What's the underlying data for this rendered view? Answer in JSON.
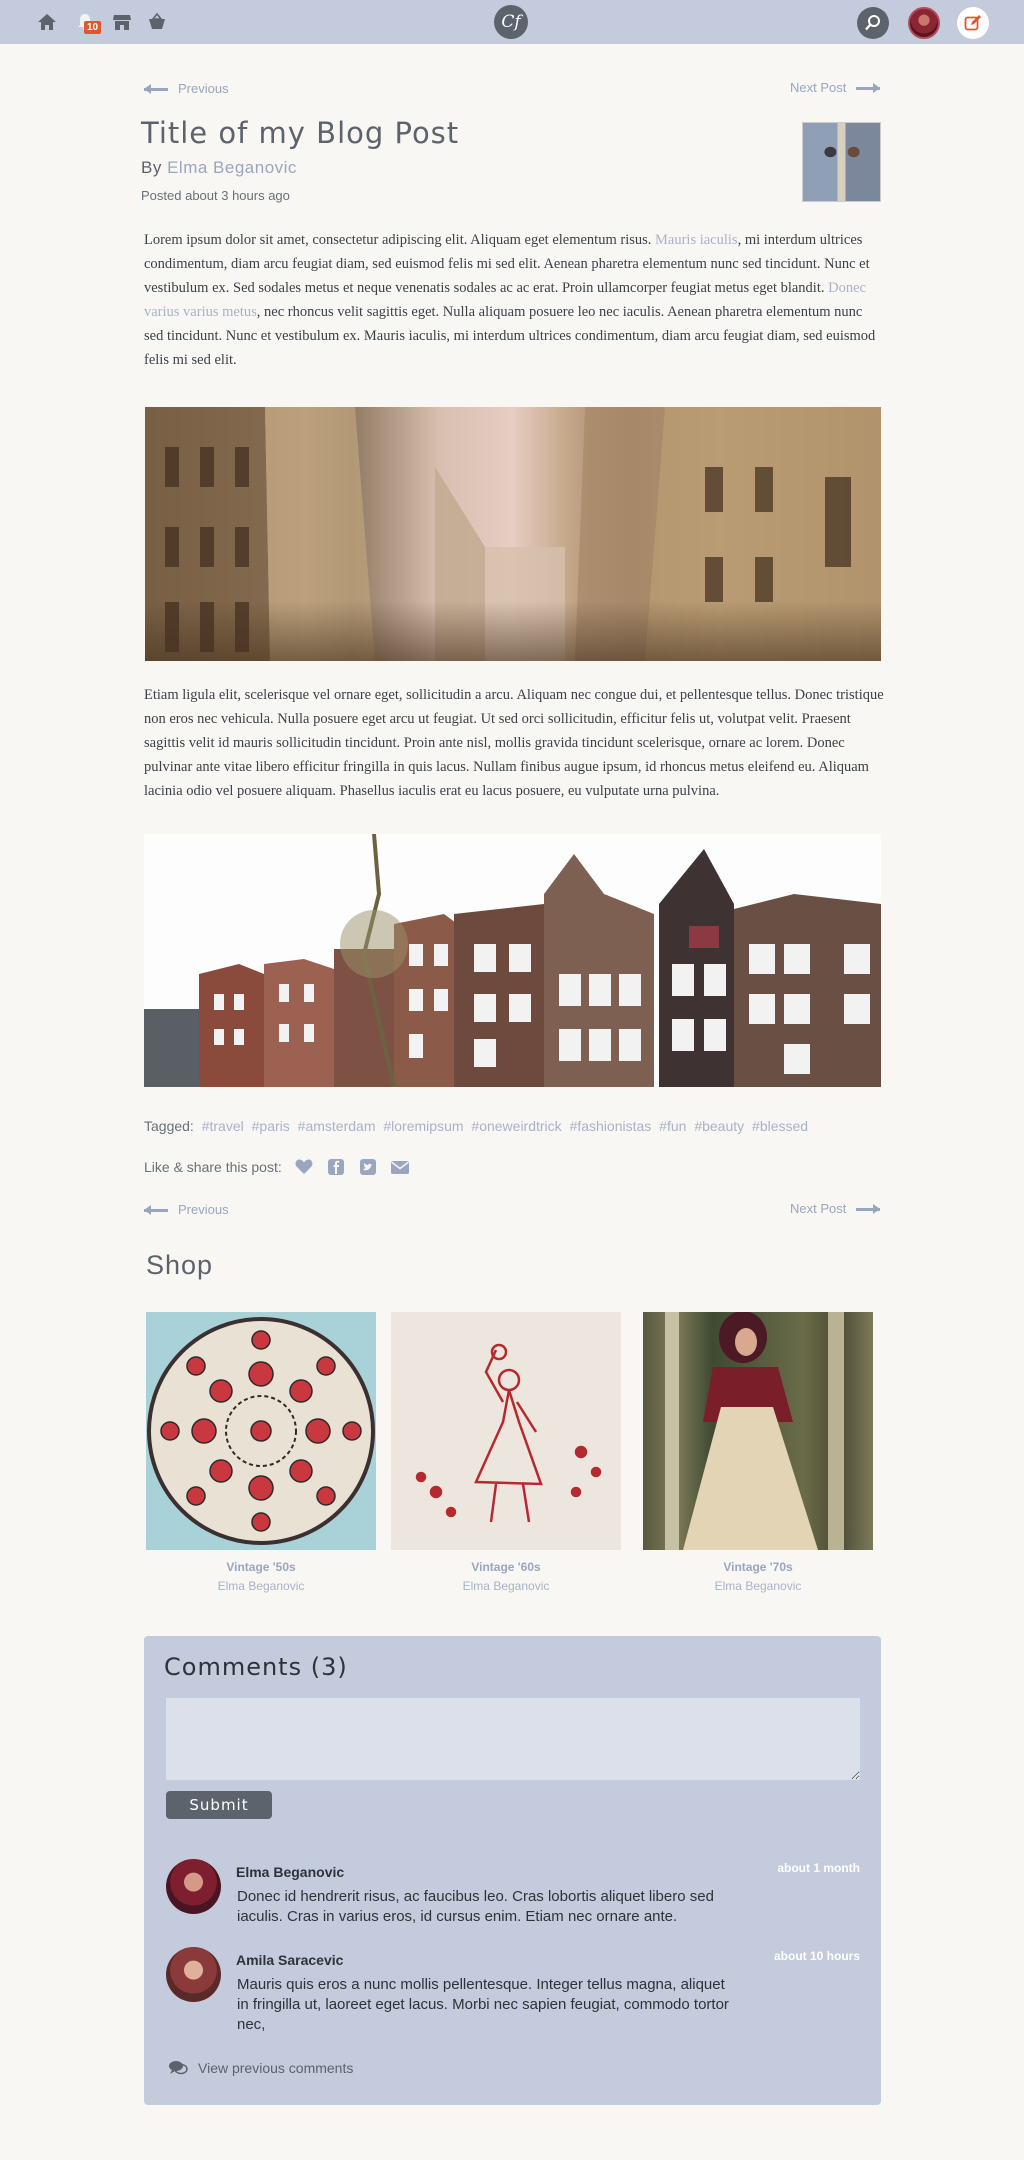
{
  "topbar": {
    "icons": [
      "home-icon",
      "notification-icon",
      "store-icon",
      "basket-icon"
    ],
    "notification_count": "10",
    "logo_text": "Cf",
    "right_icons": [
      "search-icon",
      "avatar",
      "compose-icon"
    ]
  },
  "nav": {
    "previous": "Previous",
    "next": "Next Post"
  },
  "post": {
    "title": "Title of my Blog Post",
    "by": "By",
    "author": "Elma Beganovic",
    "posted": "Posted about 3 hours ago",
    "para1_a": "Lorem ipsum dolor sit amet, consectetur adipiscing elit. Aliquam eget elementum risus. ",
    "para1_link1": "Mauris iaculis",
    "para1_b": ", mi interdum ultrices condimentum, diam arcu feugiat diam, sed euismod felis mi sed elit. Aenean pharetra elementum nunc sed tincidunt. Nunc et vestibulum ex. Sed sodales metus et neque venenatis sodales ac ac erat. Proin ullamcorper feugiat metus eget blandit. ",
    "para1_link2": "Donec varius varius metus",
    "para1_c": ", nec rhoncus velit sagittis eget. Nulla aliquam posuere leo nec iaculis. Aenean pharetra elementum nunc sed tincidunt. Nunc et vestibulum ex. Mauris iaculis, mi interdum ultrices condimentum, diam arcu feugiat diam, sed euismod felis mi sed elit.",
    "para2": "Etiam ligula elit, scelerisque vel ornare eget, sollicitudin a arcu. Aliquam nec congue dui, et pellentesque tellus. Donec tristique non eros nec vehicula. Nulla posuere eget arcu ut feugiat. Ut sed orci sollicitudin, efficitur felis ut, volutpat velit. Praesent sagittis velit id mauris sollicitudin tincidunt. Proin ante nisl, mollis gravida tincidunt scelerisque, ornare ac lorem. Donec pulvinar ante vitae libero efficitur fringilla in quis lacus. Nullam finibus augue ipsum, id rhoncus metus eleifend eu. Aliquam lacinia odio vel posuere aliquam. Phasellus iaculis erat eu lacus posuere, eu vulputate urna pulvina.",
    "tagged_label": "Tagged:",
    "tags": [
      "#travel",
      "#paris",
      "#amsterdam",
      "#loremipsum",
      "#oneweirdtrick",
      "#fashionistas",
      "#fun",
      "#beauty",
      "#blessed"
    ],
    "share_label": "Like & share this post:",
    "share_icons": [
      "heart-icon",
      "facebook-icon",
      "twitter-icon",
      "mail-icon"
    ]
  },
  "shop": {
    "title": "Shop",
    "items": [
      {
        "name": "Vintage '50s",
        "seller": "Elma Beganovic"
      },
      {
        "name": "Vintage '60s",
        "seller": "Elma Beganovic"
      },
      {
        "name": "Vintage '70s",
        "seller": "Elma Beganovic"
      }
    ]
  },
  "comments": {
    "title": "Comments (3)",
    "input_placeholder": "",
    "submit_label": "Submit",
    "items": [
      {
        "author": "Elma Beganovic",
        "time": "about 1 month",
        "text": "Donec id hendrerit risus, ac faucibus leo. Cras lobortis aliquet libero sed iaculis. Cras in varius eros, id cursus enim. Etiam nec ornare ante."
      },
      {
        "author": "Amila Saracevic",
        "time": "about 10 hours",
        "text": "Mauris quis eros a nunc mollis pellentesque. Integer tellus magna, aliquet in fringilla ut, laoreet eget lacus. Morbi nec sapien feugiat, commodo tortor nec,"
      }
    ],
    "view_previous": "View previous comments"
  },
  "colors": {
    "topbar": "#c3cbdc",
    "accent": "#9aa5bf",
    "dark": "#5d636d",
    "badge": "#e0562f",
    "page_bg": "#f8f7f3"
  }
}
